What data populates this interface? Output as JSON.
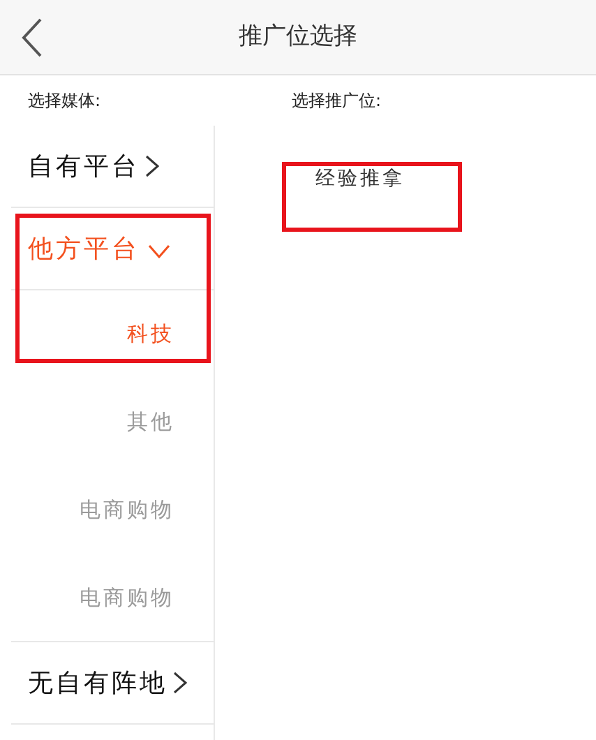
{
  "header": {
    "title": "推广位选择"
  },
  "media_label": "选择媒体:",
  "slot_label": "选择推广位:",
  "media_groups": [
    {
      "label": "自有平台",
      "expanded": false
    },
    {
      "label": "他方平台",
      "expanded": true,
      "children": [
        {
          "label": "科技",
          "selected": true
        },
        {
          "label": "其他",
          "selected": false
        },
        {
          "label": "电商购物",
          "selected": false
        },
        {
          "label": "电商购物",
          "selected": false
        }
      ]
    },
    {
      "label": "无自有阵地",
      "expanded": false
    }
  ],
  "slots": [
    "经验推拿"
  ]
}
